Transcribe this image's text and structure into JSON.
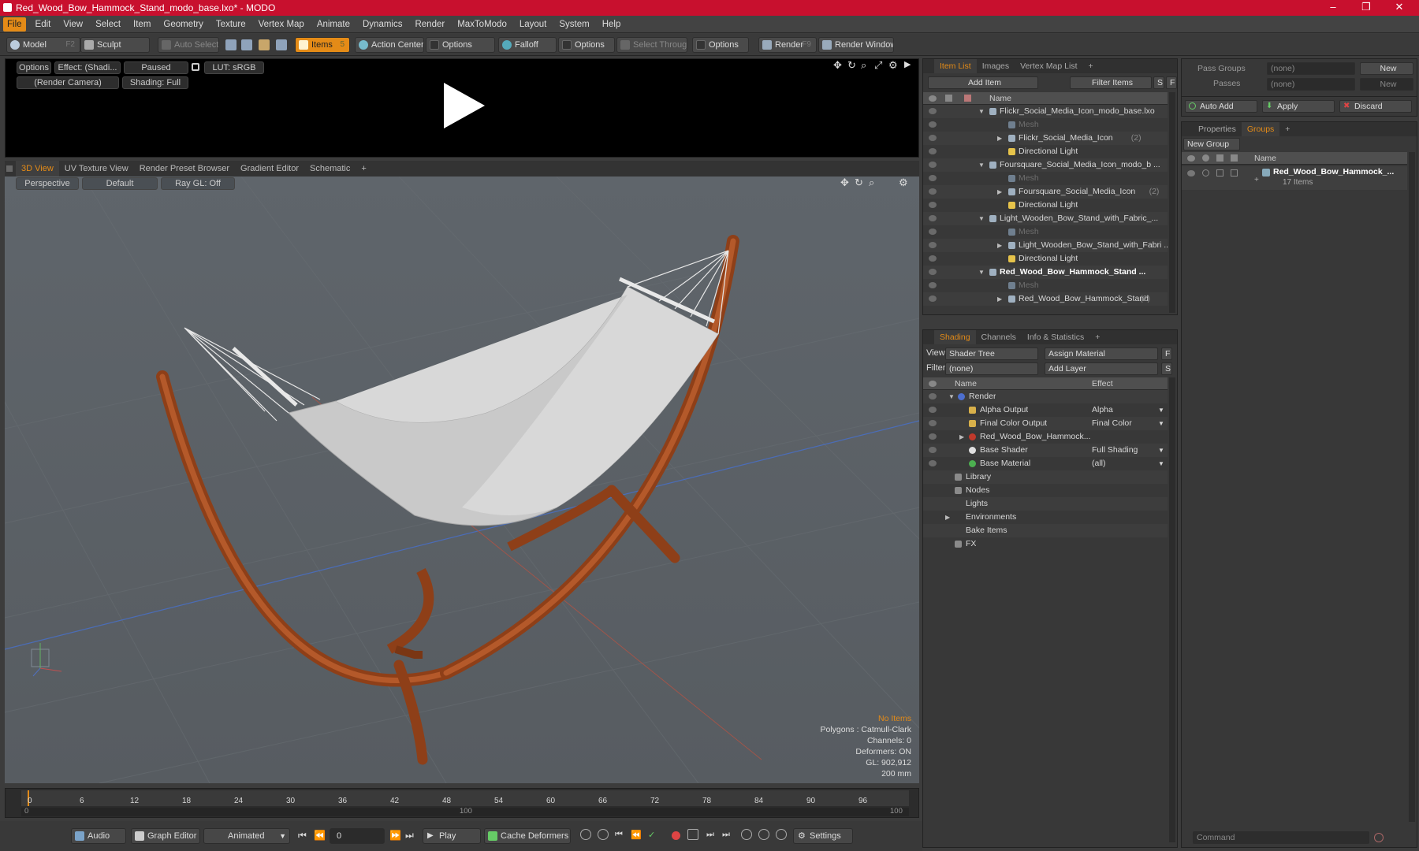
{
  "window": {
    "title": "Red_Wood_Bow_Hammock_Stand_modo_base.lxo* - MODO",
    "minimize": "–",
    "maximize": "❐",
    "close": "✕"
  },
  "menu": [
    "File",
    "Edit",
    "View",
    "Select",
    "Item",
    "Geometry",
    "Texture",
    "Vertex Map",
    "Animate",
    "Dynamics",
    "Render",
    "MaxToModo",
    "Layout",
    "System",
    "Help"
  ],
  "toolbar": {
    "model": "Model",
    "model_key": "F2",
    "sculpt": "Sculpt",
    "auto_select": "Auto Select",
    "items": "Items",
    "items_key": "5",
    "action_center": "Action Center",
    "options1": "Options",
    "falloff": "Falloff",
    "options2": "Options",
    "select_through": "Select Through",
    "options3": "Options",
    "render": "Render",
    "render_key": "F9",
    "render_window": "Render Window"
  },
  "preview": {
    "options": "Options",
    "effect": "Effect: (Shadi...",
    "paused": "Paused",
    "lut": "LUT: sRGB",
    "camera": "(Render Camera)",
    "shading": "Shading: Full"
  },
  "viewport_tabs": [
    "3D View",
    "UV Texture View",
    "Render Preset Browser",
    "Gradient Editor",
    "Schematic",
    "+"
  ],
  "viewport": {
    "perspective": "Perspective",
    "default": "Default",
    "raygl": "Ray GL: Off",
    "stats": {
      "no_items": "No Items",
      "polygons": "Polygons : Catmull-Clark",
      "channels": "Channels: 0",
      "deformers": "Deformers: ON",
      "gl": "GL: 902,912",
      "scale": "200 mm"
    }
  },
  "timeline": {
    "ticks": [
      "0",
      "6",
      "12",
      "18",
      "24",
      "30",
      "36",
      "42",
      "48",
      "54",
      "60",
      "66",
      "72",
      "78",
      "84",
      "90",
      "96"
    ],
    "range_start": "0",
    "range_mid": "100",
    "range_end": "100"
  },
  "bottombar": {
    "audio": "Audio",
    "graph_editor": "Graph Editor",
    "animated": "Animated",
    "frame": "0",
    "play": "Play",
    "cache": "Cache Deformers",
    "settings": "Settings"
  },
  "item_list": {
    "tabs": [
      "Item List",
      "Images",
      "Vertex Map List",
      "+"
    ],
    "add_item": "Add Item",
    "filter": "Filter Items",
    "s": "S",
    "f": "F",
    "col_name": "Name",
    "rows": [
      {
        "label": "Flickr_Social_Media_Icon_modo_base.lxo",
        "indent": 0,
        "kind": "scene",
        "count": ""
      },
      {
        "label": "Mesh",
        "indent": 1,
        "kind": "mesh",
        "count": ""
      },
      {
        "label": "Flickr_Social_Media_Icon",
        "indent": 1,
        "kind": "group",
        "count": "(2)"
      },
      {
        "label": "Directional Light",
        "indent": 1,
        "kind": "light",
        "count": ""
      },
      {
        "label": "Foursquare_Social_Media_Icon_modo_b ...",
        "indent": 0,
        "kind": "scene",
        "count": ""
      },
      {
        "label": "Mesh",
        "indent": 1,
        "kind": "mesh",
        "count": ""
      },
      {
        "label": "Foursquare_Social_Media_Icon",
        "indent": 1,
        "kind": "group",
        "count": "(2)"
      },
      {
        "label": "Directional Light",
        "indent": 1,
        "kind": "light",
        "count": ""
      },
      {
        "label": "Light_Wooden_Bow_Stand_with_Fabric_...",
        "indent": 0,
        "kind": "scene",
        "count": ""
      },
      {
        "label": "Mesh",
        "indent": 1,
        "kind": "mesh",
        "count": ""
      },
      {
        "label": "Light_Wooden_Bow_Stand_with_Fabri ...",
        "indent": 1,
        "kind": "group",
        "count": ""
      },
      {
        "label": "Directional Light",
        "indent": 1,
        "kind": "light",
        "count": ""
      },
      {
        "label": "Red_Wood_Bow_Hammock_Stand ...",
        "indent": 0,
        "kind": "scene-bold",
        "count": ""
      },
      {
        "label": "Mesh",
        "indent": 1,
        "kind": "mesh",
        "count": ""
      },
      {
        "label": "Red_Wood_Bow_Hammock_Stand",
        "indent": 1,
        "kind": "group",
        "count": "(2)"
      }
    ]
  },
  "shading": {
    "tabs": [
      "Shading",
      "Channels",
      "Info & Statistics",
      "+"
    ],
    "view_label": "View",
    "view_value": "Shader Tree",
    "assign": "Assign Material",
    "f": "F",
    "filter_label": "Filter",
    "filter_value": "(none)",
    "add_layer": "Add Layer",
    "s": "S",
    "col_name": "Name",
    "col_effect": "Effect",
    "rows": [
      {
        "label": "Render",
        "effect": "",
        "indent": 0
      },
      {
        "label": "Alpha Output",
        "effect": "Alpha",
        "indent": 1
      },
      {
        "label": "Final Color Output",
        "effect": "Final Color",
        "indent": 1
      },
      {
        "label": "Red_Wood_Bow_Hammock...",
        "effect": "",
        "indent": 1
      },
      {
        "label": "Base Shader",
        "effect": "Full Shading",
        "indent": 1
      },
      {
        "label": "Base Material",
        "effect": "(all)",
        "indent": 1
      },
      {
        "label": "Library",
        "effect": "",
        "indent": 0
      },
      {
        "label": "Nodes",
        "effect": "",
        "indent": 0
      },
      {
        "label": "Lights",
        "effect": "",
        "indent": 0
      },
      {
        "label": "Environments",
        "effect": "",
        "indent": 0
      },
      {
        "label": "Bake Items",
        "effect": "",
        "indent": 0
      },
      {
        "label": "FX",
        "effect": "",
        "indent": 0
      }
    ]
  },
  "right_panel": {
    "pass_groups": "Pass Groups",
    "pass_none": "(none)",
    "new": "New",
    "passes": "Passes",
    "passes_none": "(none)",
    "new2": "New",
    "auto_add": "Auto Add",
    "apply": "Apply",
    "discard": "Discard",
    "tabs": [
      "Properties",
      "Groups",
      "+"
    ],
    "new_group": "New Group",
    "col_name": "Name",
    "group_name": "Red_Wood_Bow_Hammock_...",
    "group_items": "17 Items",
    "command": "Command"
  },
  "colors": {
    "accent": "#e48b17",
    "titlebar": "#c8102e",
    "wood": "#9b4a1f",
    "fabric": "#dcdcdc"
  }
}
